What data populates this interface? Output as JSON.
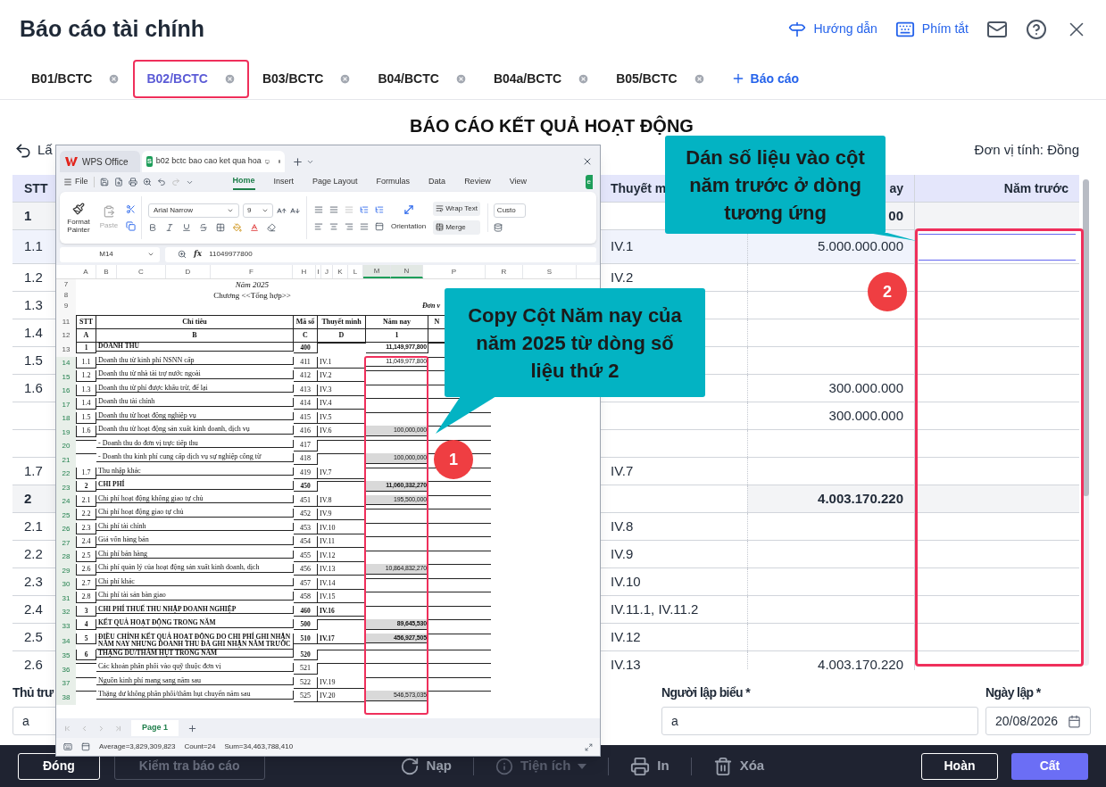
{
  "window": {
    "title": "Báo cáo tài chính"
  },
  "header_actions": [
    {
      "kind": "guide",
      "label": "Hướng dẫn"
    },
    {
      "kind": "shortcuts",
      "label": "Phím tắt"
    },
    {
      "kind": "mail"
    },
    {
      "kind": "help"
    },
    {
      "kind": "close"
    }
  ],
  "tabs": [
    {
      "label": "B01/BCTC",
      "selected": false
    },
    {
      "label": "B02/BCTC",
      "selected": true
    },
    {
      "label": "B03/BCTC",
      "selected": false
    },
    {
      "label": "B04/BCTC",
      "selected": false
    },
    {
      "label": "B04a/BCTC",
      "selected": false
    },
    {
      "label": "B05/BCTC",
      "selected": false
    }
  ],
  "add_report": "Báo cáo",
  "report": {
    "title": "BÁO CÁO KẾT QUẢ HOẠT ĐỘNG",
    "back_label": "Lấ",
    "unit": "Đơn vị tính: Đồng"
  },
  "table": {
    "columns": [
      "STT",
      "Thuyết m",
      "ay",
      "Năm trước"
    ],
    "rows": [
      {
        "stt": "1",
        "kind": "group",
        "selected": false,
        "this_year": "00"
      },
      {
        "stt": "1.1",
        "kind": "item",
        "selected": true,
        "note": "IV.1",
        "this_year": "5.000.000.000"
      },
      {
        "stt": "1.2",
        "kind": "item",
        "selected": false,
        "note": "IV.2"
      },
      {
        "stt": "1.3",
        "kind": "item",
        "selected": false
      },
      {
        "stt": "1.4",
        "kind": "item",
        "selected": false
      },
      {
        "stt": "1.5",
        "kind": "item",
        "selected": false
      },
      {
        "stt": "1.6",
        "kind": "item",
        "selected": false,
        "this_year": "300.000.000"
      },
      {
        "kind": "item",
        "selected": false,
        "this_year": "300.000.000"
      },
      {
        "kind": "item",
        "selected": false
      },
      {
        "stt": "1.7",
        "kind": "item",
        "selected": false,
        "note": "IV.7"
      },
      {
        "stt": "2",
        "kind": "group",
        "selected": false,
        "this_year": "4.003.170.220"
      },
      {
        "stt": "2.1",
        "kind": "item",
        "selected": false,
        "note": "IV.8"
      },
      {
        "stt": "2.2",
        "kind": "item",
        "selected": false,
        "note": "IV.9"
      },
      {
        "stt": "2.3",
        "kind": "item",
        "selected": false,
        "note": "IV.10"
      },
      {
        "stt": "2.4",
        "kind": "item",
        "selected": false,
        "note": "IV.11.1, IV.11.2"
      },
      {
        "stt": "2.5",
        "kind": "item",
        "selected": false,
        "note": "IV.12"
      },
      {
        "stt": "2.6",
        "kind": "item",
        "selected": false,
        "note": "IV.13",
        "this_year": "4.003.170.220"
      }
    ]
  },
  "form": [
    {
      "label": "Thủ trư",
      "value": "a",
      "kind": "text"
    },
    {
      "label": "Người lập biểu *",
      "value": "a",
      "kind": "text"
    },
    {
      "label": "Ngày lập *",
      "value": "20/08/2026",
      "kind": "date"
    }
  ],
  "footer": {
    "left": [
      {
        "label": "Đóng",
        "disabled": false
      },
      {
        "label": "Kiểm tra báo cáo",
        "disabled": true
      }
    ],
    "center": [
      {
        "kind": "reload",
        "label": "Nạp",
        "disabled": false
      },
      {
        "kind": "utilities",
        "label": "Tiện ích",
        "disabled": true
      },
      {
        "kind": "print",
        "label": "In",
        "disabled": false
      },
      {
        "kind": "delete",
        "label": "Xóa",
        "disabled": false
      }
    ],
    "right": [
      {
        "label": "Hoàn",
        "kind": "outline"
      },
      {
        "label": "Cất",
        "kind": "primary"
      }
    ]
  },
  "spreadsheet": {
    "app_tab": "WPS Office",
    "file_tab": "b02 bctc bao cao ket qua hoa",
    "file_badge": "S",
    "menu_file": "File",
    "ribbon_tabs": [
      {
        "label": "Home",
        "selected": true
      },
      {
        "label": "Insert",
        "selected": false
      },
      {
        "label": "Page Layout",
        "selected": false
      },
      {
        "label": "Formulas",
        "selected": false
      },
      {
        "label": "Data",
        "selected": false
      },
      {
        "label": "Review",
        "selected": false
      },
      {
        "label": "View",
        "selected": false
      }
    ],
    "share_button": "e",
    "ribbon": {
      "format_painter": "Format Painter",
      "paste": "Paste",
      "paste_disabled": true,
      "font": "Arial Narrow",
      "size": "9",
      "orientation": "Orientation",
      "wrap_text": "Wrap Text",
      "merge": "Merge",
      "number_format": "Custo"
    },
    "cell_ref": "M14",
    "fx": "fx",
    "formula": "11049977800",
    "columns": [
      {
        "label": "A",
        "selected": false
      },
      {
        "label": "B",
        "selected": false
      },
      {
        "label": "C",
        "selected": false
      },
      {
        "label": "D",
        "selected": false
      },
      {
        "label": "F",
        "selected": false
      },
      {
        "label": "H",
        "selected": false
      },
      {
        "label": "I",
        "selected": false
      },
      {
        "label": "J",
        "selected": false
      },
      {
        "label": "K",
        "selected": false
      },
      {
        "label": "L",
        "selected": false
      },
      {
        "label": "M",
        "selected": true
      },
      {
        "label": "N",
        "selected": true
      },
      {
        "label": "P",
        "selected": false
      },
      {
        "label": "R",
        "selected": false
      },
      {
        "label": "S",
        "selected": false
      }
    ],
    "title_rows": [
      {
        "row": "7",
        "text": "Năm 2025",
        "kind": "year"
      },
      {
        "row": "8",
        "text": "Chương <<Tổng hợp>>",
        "kind": "chapter"
      },
      {
        "row": "9",
        "text": "Đơn v",
        "kind": "unit"
      }
    ],
    "header_rows": [
      {
        "row": "11",
        "cells": [
          "STT",
          "Chỉ tiêu",
          "Mã số",
          "Thuyết minh",
          "Năm nay",
          "N"
        ]
      },
      {
        "row": "12",
        "cells": [
          "A",
          "B",
          "C",
          "D",
          "1"
        ]
      }
    ],
    "rows": [
      {
        "row": "13",
        "stt": "1",
        "name": "DOANH THU",
        "code": "400",
        "value": "11,149,977,800",
        "bold": true,
        "selected": false,
        "active": false
      },
      {
        "row": "14",
        "stt": "1.1",
        "name": "Doanh thu từ kinh phí NSNN cấp",
        "code": "411",
        "note": "IV.1",
        "value": "11,049,977,800",
        "bold": false,
        "selected": true,
        "active": true
      },
      {
        "row": "15",
        "stt": "1.2",
        "name": "Doanh thu từ nhà tài trợ nước ngoài",
        "code": "412",
        "note": "IV.2",
        "bold": false,
        "selected": true,
        "active": false
      },
      {
        "row": "16",
        "stt": "1.3",
        "name": "Doanh thu từ phí được khấu trừ, để lại",
        "code": "413",
        "note": "IV.3",
        "bold": false,
        "selected": true,
        "active": false
      },
      {
        "row": "17",
        "stt": "1.4",
        "name": "Doanh thu tài chính",
        "code": "414",
        "note": "IV.4",
        "bold": false,
        "selected": true,
        "active": false
      },
      {
        "row": "18",
        "stt": "1.5",
        "name": "Doanh thu từ hoạt động nghiệp vụ",
        "code": "415",
        "note": "IV.5",
        "bold": false,
        "selected": true,
        "active": false
      },
      {
        "row": "19",
        "stt": "1.6",
        "name": "Doanh thu từ hoạt động sản xuất kinh doanh, dịch vụ",
        "code": "416",
        "note": "IV.6",
        "value": "100,000,000",
        "bold": false,
        "selected": true,
        "active": false
      },
      {
        "row": "20",
        "name": "- Doanh thu do đơn vị trực tiếp thu",
        "code": "417",
        "bold": false,
        "selected": true,
        "active": false
      },
      {
        "row": "21",
        "name": "- Doanh thu kinh phí cung cấp dịch vụ sự nghiệp công từ",
        "code": "418",
        "value": "100,000,000",
        "bold": false,
        "selected": true,
        "active": false
      },
      {
        "row": "22",
        "stt": "1.7",
        "name": "Thu nhập khác",
        "code": "419",
        "note": "IV.7",
        "bold": false,
        "selected": true,
        "active": false
      },
      {
        "row": "23",
        "stt": "2",
        "name": "CHI PHÍ",
        "code": "450",
        "value": "11,060,332,270",
        "bold": true,
        "selected": true,
        "active": false
      },
      {
        "row": "24",
        "stt": "2.1",
        "name": "Chi phí hoạt động không giao tự chủ",
        "code": "451",
        "note": "IV.8",
        "value": "195,500,000",
        "bold": false,
        "selected": true,
        "active": false
      },
      {
        "row": "25",
        "stt": "2.2",
        "name": "Chi phí hoạt động giao tự chủ",
        "code": "452",
        "note": "IV.9",
        "bold": false,
        "selected": true,
        "active": false
      },
      {
        "row": "26",
        "stt": "2.3",
        "name": "Chi phí tài chính",
        "code": "453",
        "note": "IV.10",
        "bold": false,
        "selected": true,
        "active": false
      },
      {
        "row": "27",
        "stt": "2.4",
        "name": "Giá vốn hàng bán",
        "code": "454",
        "note": "IV.11",
        "bold": false,
        "selected": true,
        "active": false
      },
      {
        "row": "28",
        "stt": "2.5",
        "name": "Chi phí bán hàng",
        "code": "455",
        "note": "IV.12",
        "bold": false,
        "selected": true,
        "active": false
      },
      {
        "row": "29",
        "stt": "2.6",
        "name": "Chi phí quản lý của hoạt động sản xuất kinh doanh, dịch",
        "code": "456",
        "note": "IV.13",
        "value": "10,864,832,270",
        "bold": false,
        "selected": true,
        "active": false
      },
      {
        "row": "30",
        "stt": "2.7",
        "name": "Chi phí khác",
        "code": "457",
        "note": "IV.14",
        "bold": false,
        "selected": true,
        "active": false
      },
      {
        "row": "31",
        "stt": "2.8",
        "name": "Chi phí tài sản bàn giao",
        "code": "458",
        "note": "IV.15",
        "bold": false,
        "selected": true,
        "active": false
      },
      {
        "row": "32",
        "stt": "3",
        "name": "CHI PHÍ THUẾ THU NHẬP DOANH NGHIỆP",
        "code": "460",
        "note": "IV.16",
        "bold": true,
        "selected": true,
        "active": false
      },
      {
        "row": "33",
        "stt": "4",
        "name": "KẾT QUẢ HOẠT ĐỘNG TRONG NĂM",
        "code": "500",
        "value": "89,645,530",
        "bold": true,
        "selected": true,
        "active": false
      },
      {
        "row": "34",
        "stt": "5",
        "name": "ĐIỀU CHỈNH KẾT QUẢ HOẠT ĐỘNG DO CHI PHÍ GHI NHẬN NĂM NAY NHƯNG DOANH THU ĐÃ GHI NHẬN NĂM TRƯỚC",
        "code": "510",
        "note": "IV.17",
        "value": "456,927,505",
        "bold": true,
        "selected": true,
        "active": false
      },
      {
        "row": "35",
        "stt": "6",
        "name": "THẶNG DƯ/THÂM HỤT TRONG NĂM",
        "code": "520",
        "bold": true,
        "selected": true,
        "active": false
      },
      {
        "row": "36",
        "name": "Các khoản phân phối vào quỹ thuộc đơn vị",
        "code": "521",
        "bold": false,
        "selected": true,
        "active": false
      },
      {
        "row": "37",
        "name": "Nguồn kinh phí mang sang năm sau",
        "code": "522",
        "note": "IV.19",
        "bold": false,
        "selected": true,
        "active": false
      },
      {
        "row": "38",
        "name": "Thặng dư không phân phối/thâm hụt chuyển năm sau",
        "code": "525",
        "note": "IV.20",
        "value": "546,573,035",
        "bold": false,
        "selected": true,
        "active": false
      }
    ],
    "sheet_tab": "Page 1",
    "status": [
      "Average=3,829,309,823",
      "Count=24",
      "Sum=34,463,788,410"
    ]
  },
  "annotations": {
    "callouts": [
      {
        "text": "Copy Cột Năm nay của năm 2025 từ dòng số liệu thứ 2"
      },
      {
        "text": "Dán số liệu vào cột năm trước ở dòng tương ứng"
      }
    ],
    "badges": [
      "1",
      "2"
    ]
  }
}
